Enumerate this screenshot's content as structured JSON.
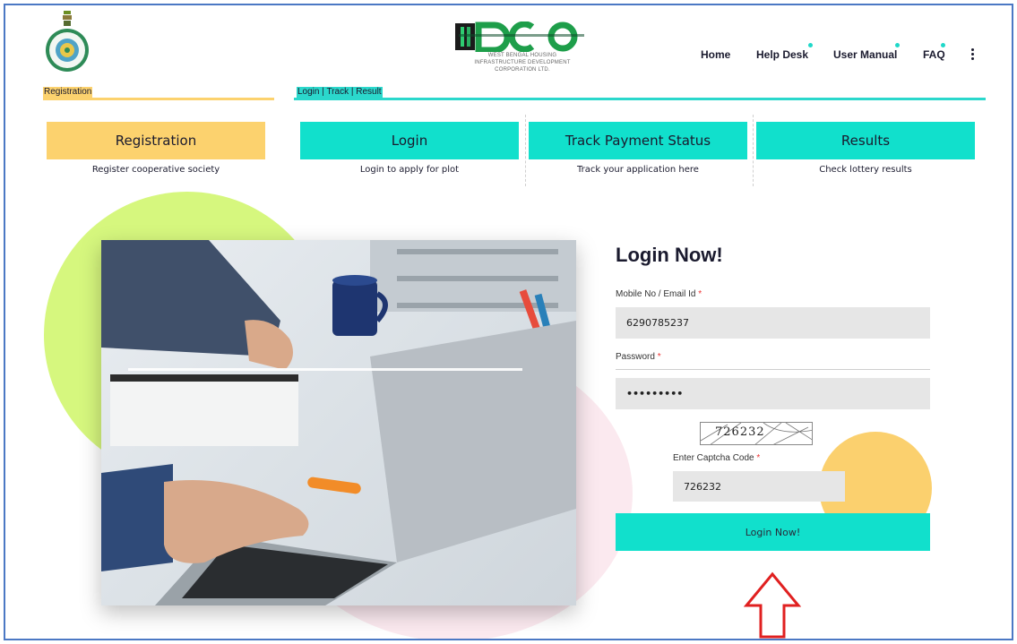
{
  "logo": {
    "brand": "IDCO",
    "line1": "WEST BENGAL HOUSING",
    "line2": "INFRASTRUCTURE DEVELOPMENT",
    "line3": "CORPORATION LTD."
  },
  "nav": {
    "home": "Home",
    "help_desk": "Help Desk",
    "user_manual": "User Manual",
    "faq": "FAQ"
  },
  "sections": {
    "registration_label": "Registration",
    "login_track_label": "Login | Track | Result"
  },
  "cards": [
    {
      "title": "Registration",
      "subtitle": "Register cooperative society"
    },
    {
      "title": "Login",
      "subtitle": "Login to apply for plot"
    },
    {
      "title": "Track Payment Status",
      "subtitle": "Track your application here"
    },
    {
      "title": "Results",
      "subtitle": "Check lottery results"
    }
  ],
  "form": {
    "title": "Login Now!",
    "mobile_label": "Mobile No / Email Id",
    "mobile_value": "6290785237",
    "password_label": "Password",
    "password_value": "•••••••••",
    "captcha_image_text": "726232",
    "captcha_label": "Enter Captcha Code",
    "captcha_value": "726232",
    "required_mark": "*",
    "submit_label": "Login Now!"
  },
  "colors": {
    "yellow": "#fcd26e",
    "teal": "#11e0cc",
    "arrow": "#e02020",
    "frame": "#4b78c4"
  }
}
